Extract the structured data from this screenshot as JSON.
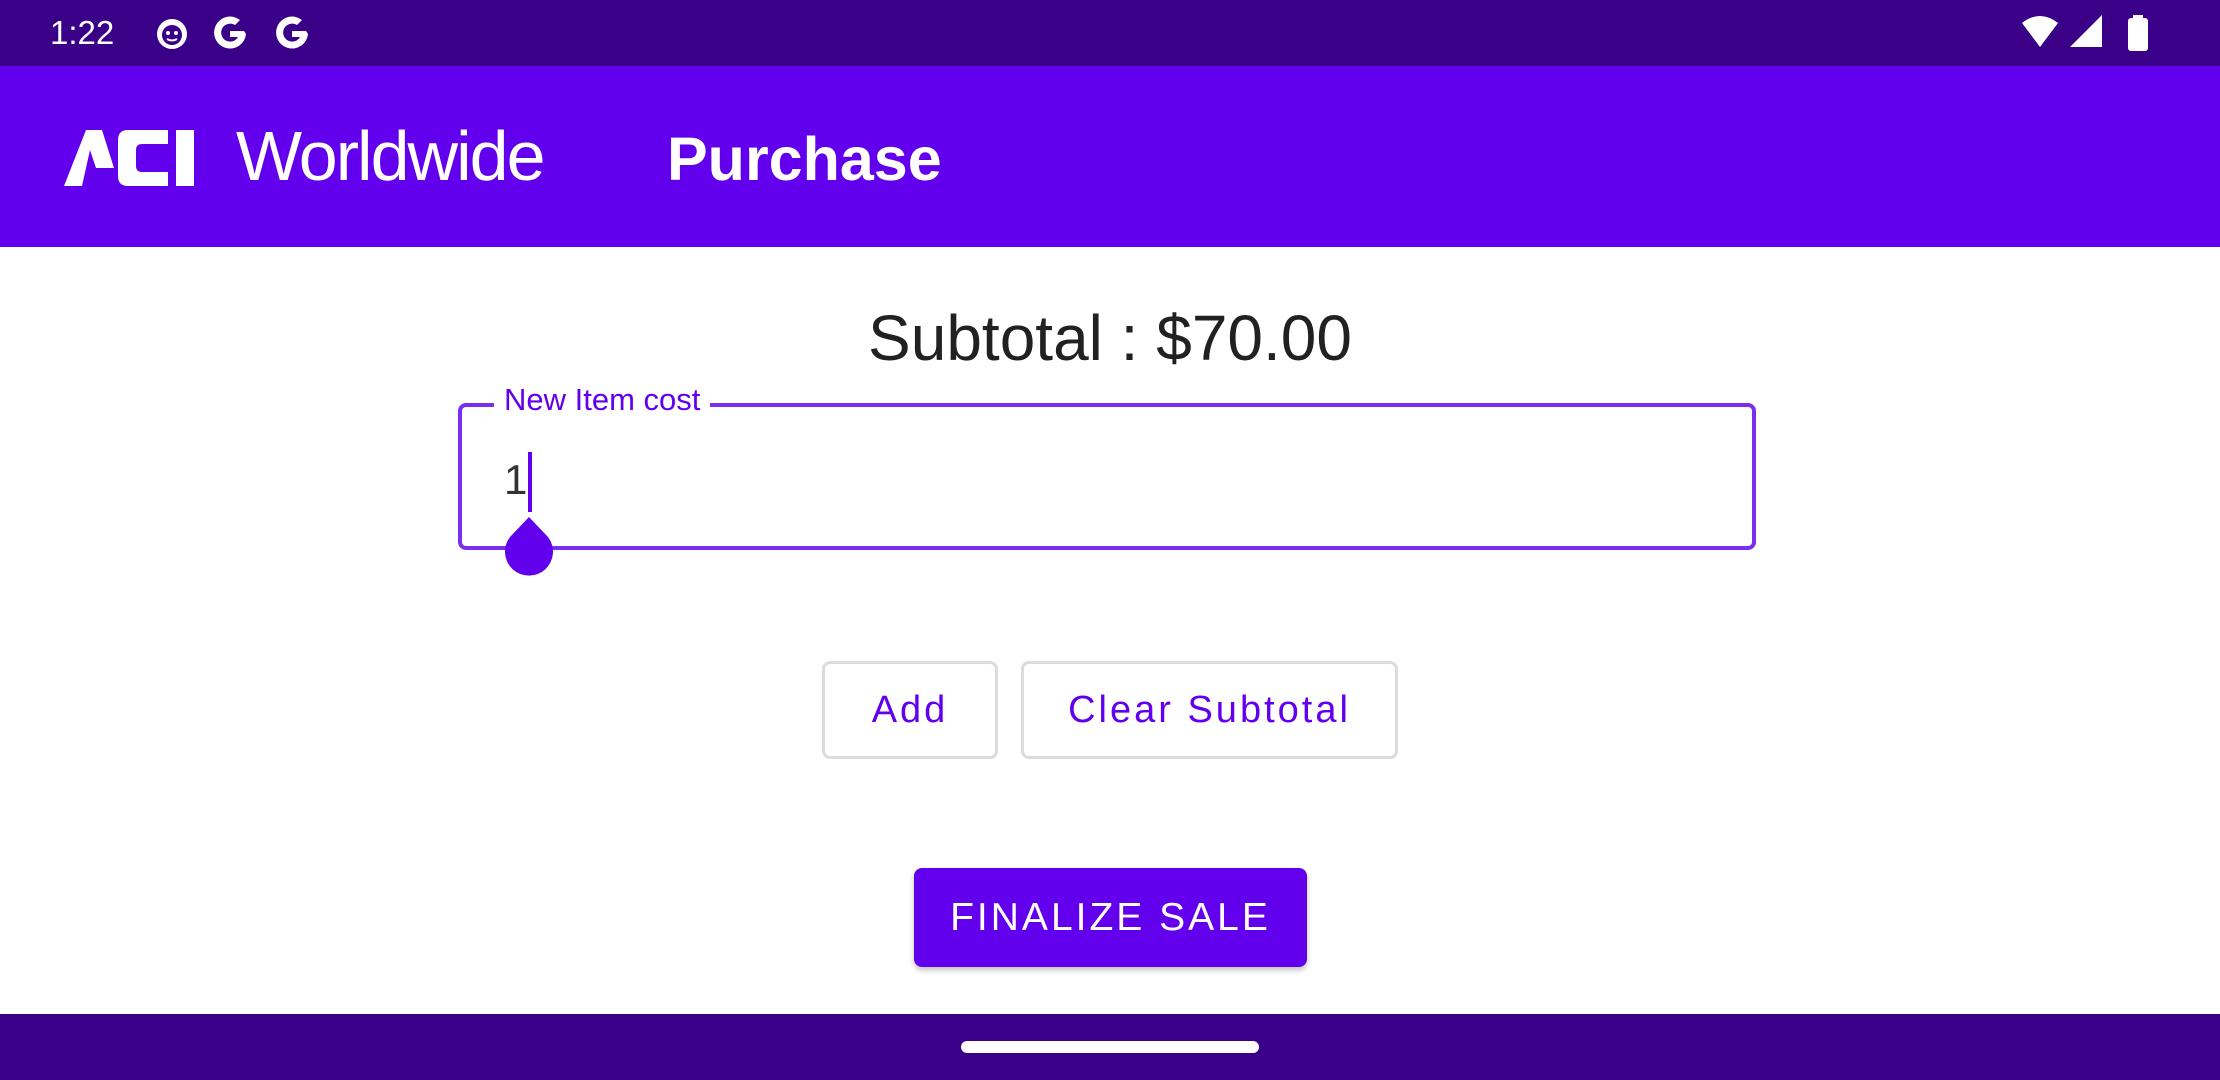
{
  "status_bar": {
    "time": "1:22",
    "left_icons": [
      "cat-notification-icon",
      "google-icon",
      "google-icon"
    ],
    "right_icons": [
      "wifi-icon",
      "cell-signal-icon",
      "battery-icon"
    ]
  },
  "app_bar": {
    "logo_mark": "ACI",
    "logo_word": "Worldwide",
    "title": "Purchase",
    "color": "#6200ee"
  },
  "main": {
    "subtotal_text": "Subtotal : $70.00",
    "item_cost_field": {
      "label": "New Item cost",
      "value": "1"
    },
    "add_button": "Add",
    "clear_button": "Clear Subtotal",
    "finalize_button": "FINALIZE SALE"
  },
  "colors": {
    "system_bar": "#3a0088",
    "accent": "#6200ee"
  }
}
